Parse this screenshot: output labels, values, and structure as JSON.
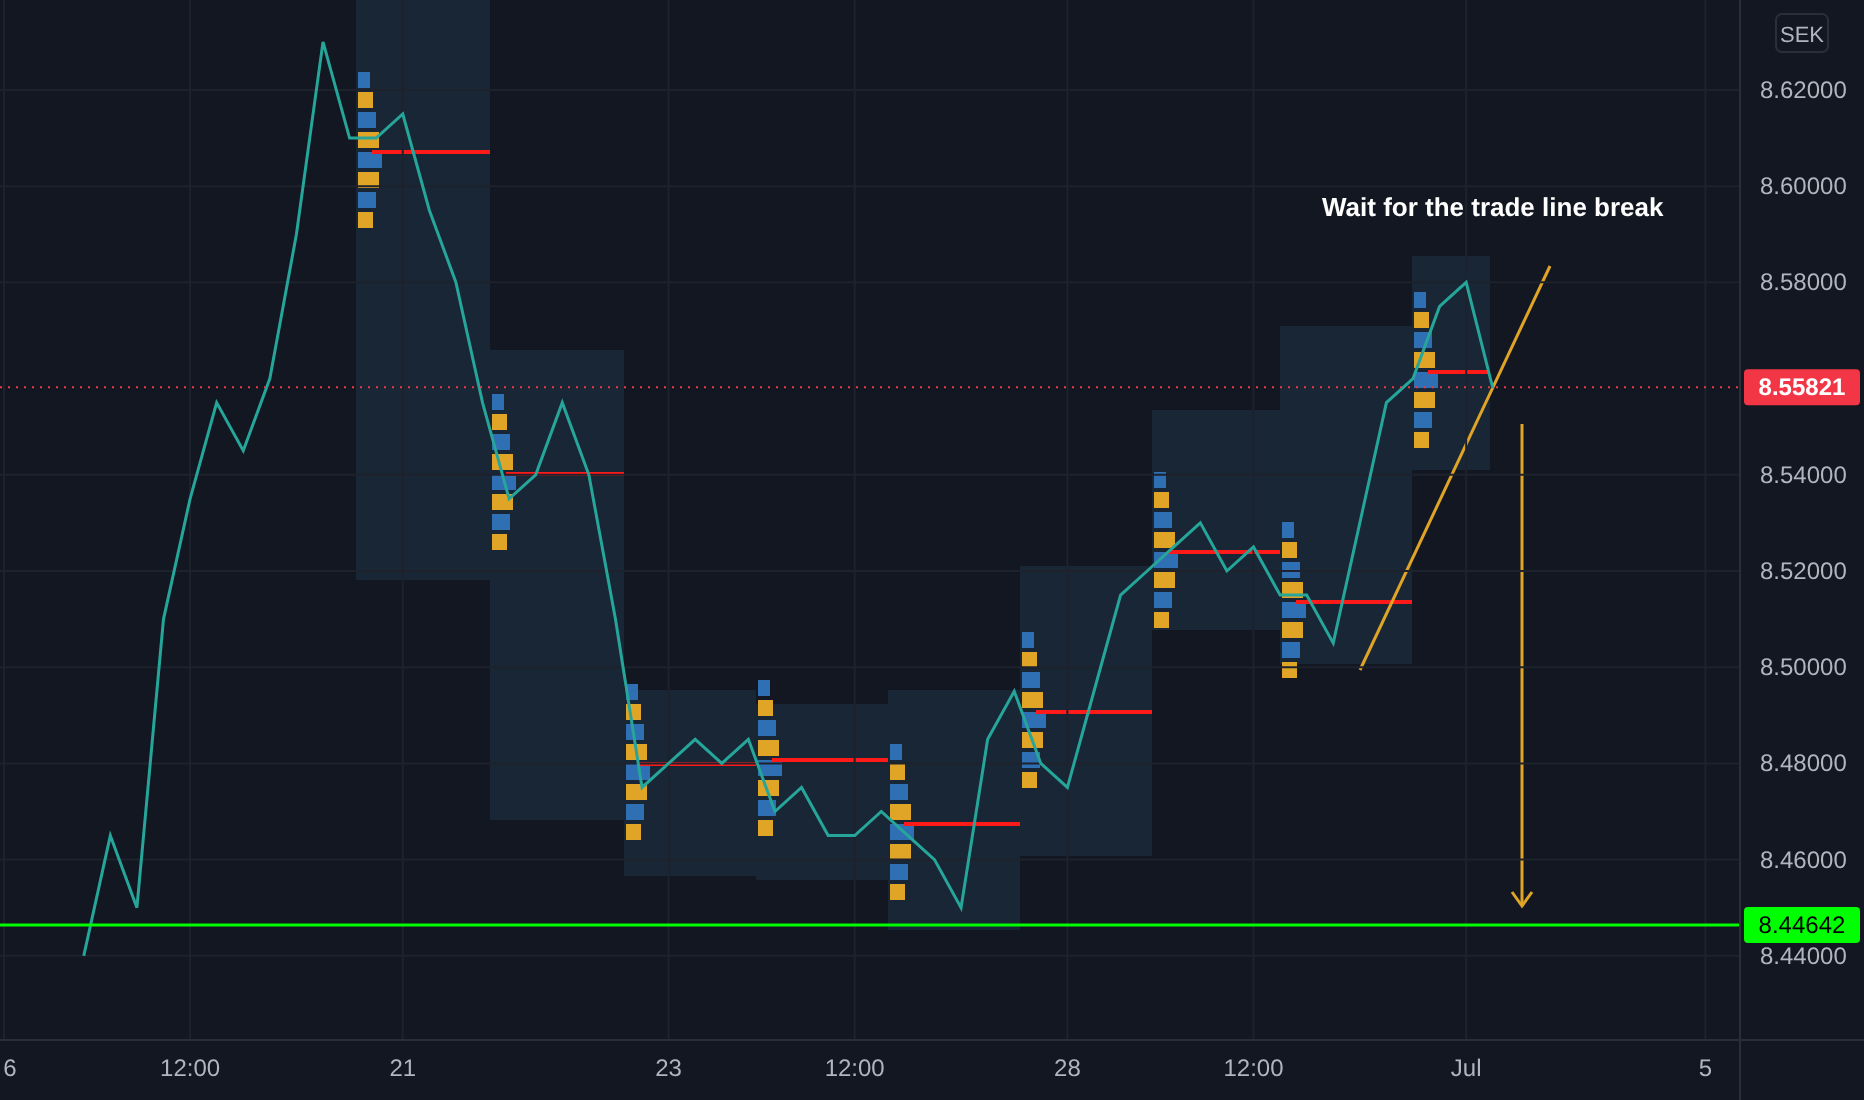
{
  "currency_button": "SEK",
  "chart_data": {
    "type": "line",
    "grid": true,
    "categories": [
      "6",
      null,
      null,
      null,
      null,
      null,
      null,
      "12:00",
      null,
      null,
      null,
      null,
      null,
      null,
      null,
      "21",
      null,
      null,
      null,
      null,
      null,
      null,
      null,
      null,
      null,
      "23",
      null,
      null,
      null,
      null,
      null,
      null,
      "12:00",
      null,
      null,
      null,
      null,
      null,
      null,
      null,
      "28",
      null,
      null,
      null,
      null,
      null,
      null,
      "12:00",
      null,
      null,
      null,
      null,
      null,
      null,
      null,
      "Jul",
      null,
      null,
      null,
      null,
      null,
      null,
      null,
      null,
      "5"
    ],
    "series": [
      {
        "color": "#26a69a",
        "values": [
          null,
          null,
          null,
          8.44,
          8.465,
          8.45,
          8.51,
          8.535,
          8.555,
          8.545,
          8.56,
          8.59,
          8.63,
          8.61,
          8.61,
          8.615,
          8.595,
          8.58,
          8.555,
          8.535,
          8.54,
          8.555,
          8.54,
          8.51,
          8.475,
          8.48,
          8.485,
          8.48,
          8.485,
          8.47,
          8.475,
          8.465,
          8.465,
          8.47,
          8.465,
          8.46,
          8.45,
          8.485,
          8.495,
          8.48,
          8.475,
          8.495,
          8.515,
          8.52,
          8.525,
          8.53,
          8.52,
          8.525,
          8.515,
          8.515,
          8.505,
          8.53,
          8.555,
          8.56,
          8.575,
          8.58,
          8.558,
          null,
          null,
          null,
          null,
          null,
          null,
          null,
          null
        ]
      }
    ],
    "ylim": [
      8.4225,
      8.6387
    ],
    "ref_lines": [
      {
        "axis": "y",
        "value": 8.55821,
        "label": "8.55821",
        "color": "#f23645"
      },
      {
        "axis": "y",
        "value": 8.44642,
        "label": "8.44642",
        "color": "#00ff00"
      }
    ],
    "yticks": [
      {
        "value": 8.62,
        "label": "8.62000"
      },
      {
        "value": 8.6,
        "label": "8.60000"
      },
      {
        "value": 8.58,
        "label": "8.58000"
      },
      {
        "value": 8.54,
        "label": "8.54000"
      },
      {
        "value": 8.52,
        "label": "8.52000"
      },
      {
        "value": 8.5,
        "label": "8.50000"
      },
      {
        "value": 8.48,
        "label": "8.48000"
      },
      {
        "value": 8.46,
        "label": "8.46000"
      },
      {
        "value": 8.44,
        "label": "8.44000"
      }
    ],
    "annotations": [
      {
        "text": "Wait for the trade line break"
      }
    ]
  }
}
